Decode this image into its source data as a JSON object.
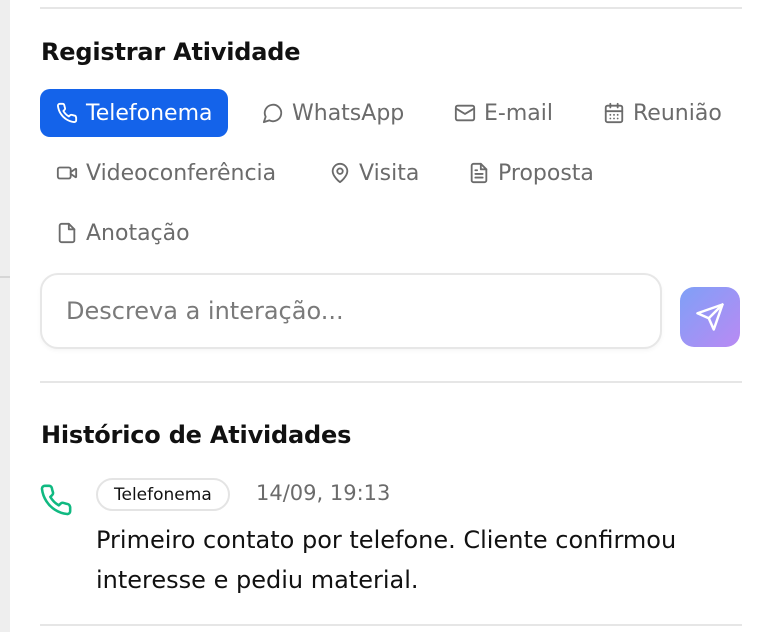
{
  "register": {
    "title": "Registrar Atividade",
    "types": [
      {
        "label": "Telefonema",
        "icon": "phone-icon",
        "active": true
      },
      {
        "label": "WhatsApp",
        "icon": "chat-bubble-icon",
        "active": false
      },
      {
        "label": "E-mail",
        "icon": "mail-icon",
        "active": false
      },
      {
        "label": "Reunião",
        "icon": "calendar-icon",
        "active": false
      },
      {
        "label": "Videoconferência",
        "icon": "video-camera-icon",
        "active": false
      },
      {
        "label": "Visita",
        "icon": "map-pin-icon",
        "active": false
      },
      {
        "label": "Proposta",
        "icon": "document-icon",
        "active": false
      },
      {
        "label": "Anotação",
        "icon": "note-icon",
        "active": false
      }
    ],
    "input": {
      "placeholder": "Descreva a interação...",
      "value": ""
    },
    "send_icon": "send-icon"
  },
  "history": {
    "title": "Histórico de Atividades",
    "entries": [
      {
        "icon": "phone-icon",
        "type_label": "Telefonema",
        "timestamp": "14/09, 19:13",
        "text": "Primeiro contato por telefone. Cliente confirmou interesse e pediu material."
      }
    ]
  },
  "colors": {
    "accent": "#1463ea",
    "history_icon": "#10b981",
    "send_gradient_start": "#7fa0f7",
    "send_gradient_end": "#b98af3"
  }
}
